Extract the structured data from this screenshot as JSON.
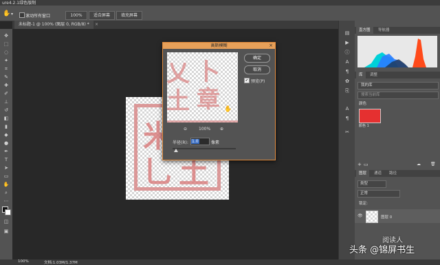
{
  "app": {
    "title": "ure4.2.1绿色版制"
  },
  "options_bar": {
    "checkbox_label": "滚动所有窗口",
    "zoom_value": "100%",
    "fit_screen": "适合屏幕",
    "fill_screen": "填充屏幕"
  },
  "document": {
    "tab_label": "未标题-1 @ 100% (图层 0, RGB/8) *"
  },
  "canvas": {
    "seal_chars": [
      "米",
      "乚",
      "土",
      "章"
    ],
    "preview_chars": [
      "乂",
      "卜",
      "土",
      "章"
    ]
  },
  "status": {
    "zoom": "100%",
    "doc_info": "文档:1.03M/1.37M"
  },
  "dialog": {
    "title": "高斯模糊",
    "ok": "确定",
    "cancel": "取消",
    "preview_label": "预览(P)",
    "zoom": "100%",
    "radius_label": "半径(R):",
    "radius_value": "1.0",
    "unit": "像素",
    "slider_fraction": 0.05
  },
  "histogram_panel": {
    "tab_active": "直方图",
    "tab_other": "导航器"
  },
  "properties_panel": {
    "tab_active": "库",
    "tab_other": "调整",
    "library_select": "我的库",
    "search_placeholder": "搜索当前库",
    "group_label": "颜色",
    "swatch_label": "颜色 1",
    "swatch_color": "#e53030"
  },
  "layers_panel": {
    "tabs": [
      "图层",
      "通道",
      "路径"
    ],
    "filter_label": "类型",
    "blend_mode": "正常",
    "lock_label": "锁定:",
    "layer_name": "图层 0"
  },
  "watermark": {
    "text": "头条 @锦屏书生",
    "sub": "阅读人"
  }
}
